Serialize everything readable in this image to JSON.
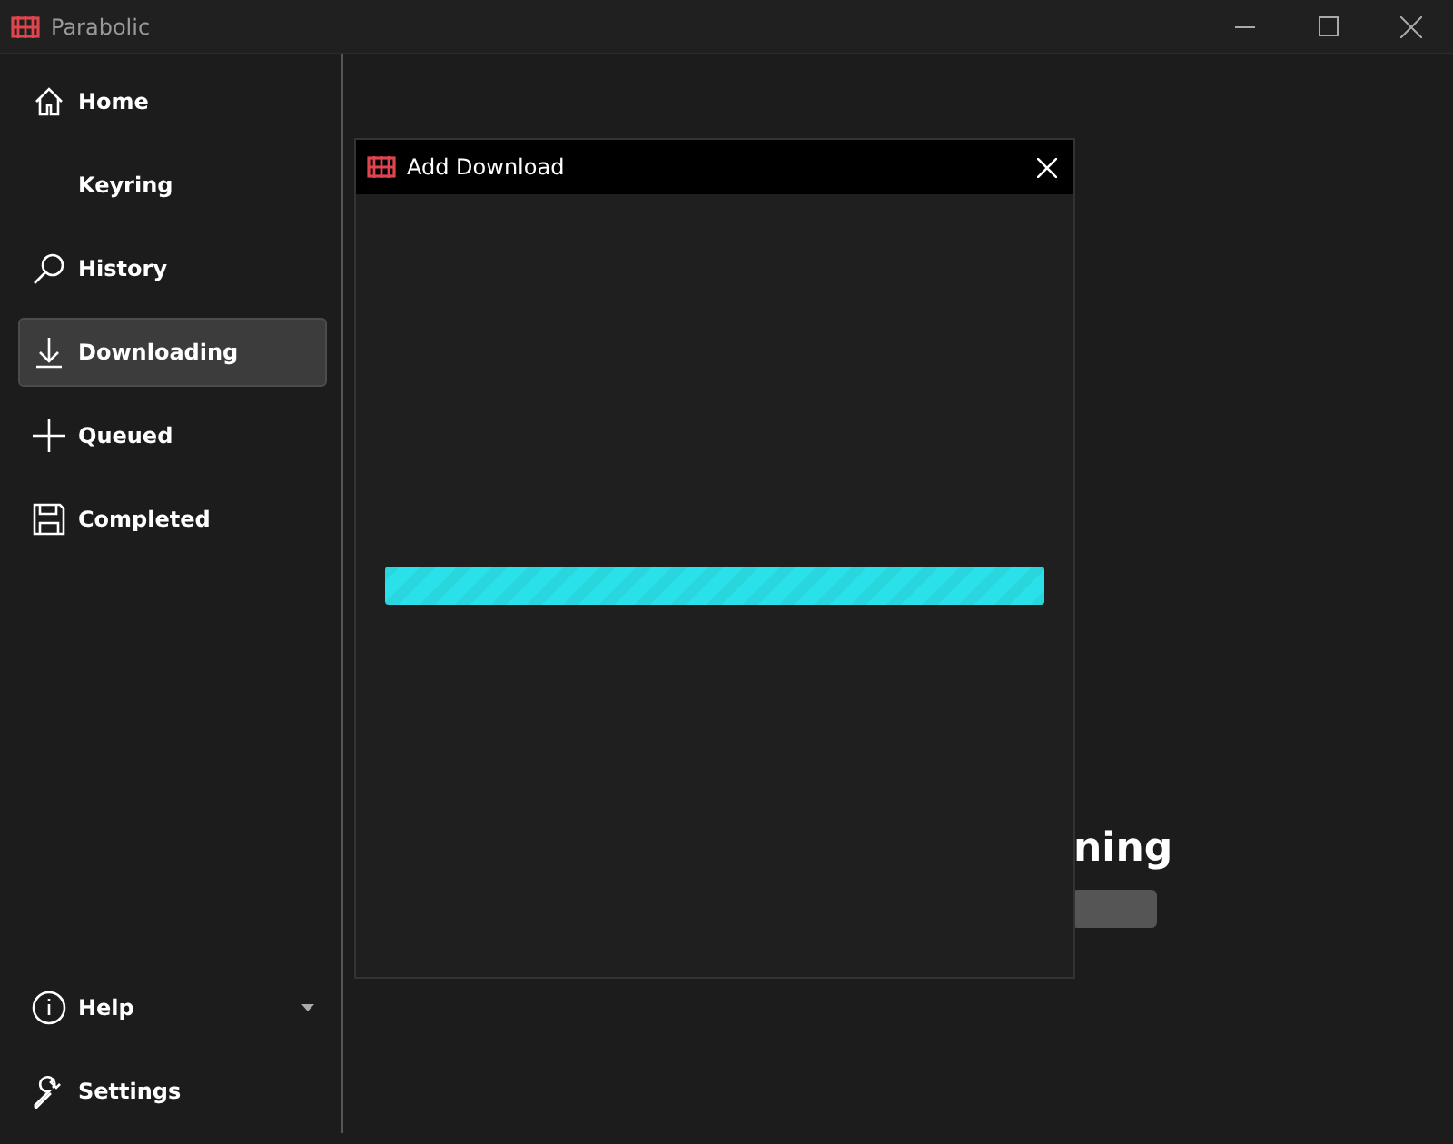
{
  "window": {
    "title": "Parabolic"
  },
  "sidebar": {
    "items": [
      {
        "label": "Home",
        "selected": false
      },
      {
        "label": "Keyring",
        "selected": false
      },
      {
        "label": "History",
        "selected": false
      },
      {
        "label": "Downloading",
        "selected": true
      },
      {
        "label": "Queued",
        "selected": false
      },
      {
        "label": "Completed",
        "selected": false
      }
    ],
    "footer_items": [
      {
        "label": "Help",
        "expandable": true
      },
      {
        "label": "Settings",
        "expandable": false
      }
    ]
  },
  "main": {
    "heading": "ning"
  },
  "dialog": {
    "title": "Add Download",
    "progress": {
      "indeterminate": true
    }
  }
}
